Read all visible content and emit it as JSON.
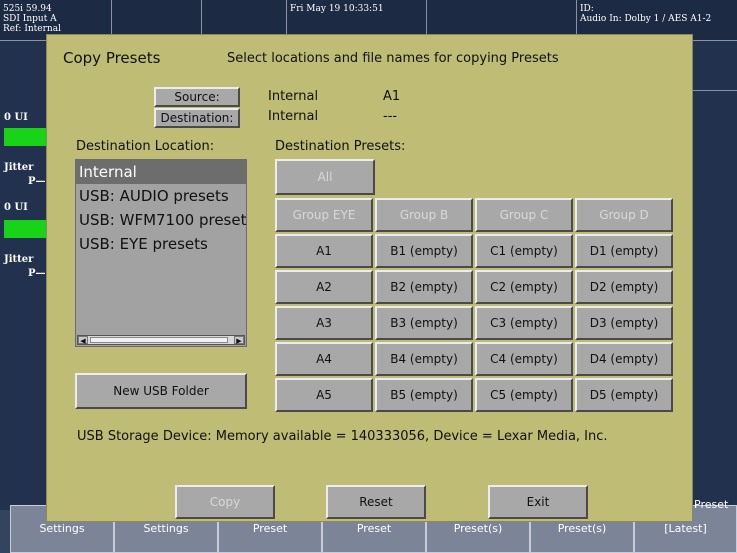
{
  "background": {
    "top_cells": [
      {
        "lines": [
          "525i 59.94",
          "SDI Input A",
          "Ref: Internal"
        ]
      },
      {
        "lines": [
          ""
        ]
      },
      {
        "lines": [
          ""
        ]
      },
      {
        "lines": [
          "Fri May 19 10:33:51"
        ]
      },
      {
        "lines": [
          ""
        ]
      },
      {
        "lines": [
          "ID:",
          "Audio In: Dolby 1 / AES A1-2"
        ]
      }
    ],
    "left_labels": [
      "0 UI",
      "Jitter",
      "P—",
      "0 UI",
      "Jitter",
      "P—"
    ],
    "bottom_buttons": [
      "Settings",
      "Settings",
      "Preset",
      "Preset",
      "Preset(s)",
      "Preset(s)",
      "[Latest]"
    ],
    "right_text": "Preset"
  },
  "dialog": {
    "title": "Copy Presets",
    "subtitle": "Select locations and file names for copying Presets",
    "source_button": "Source:",
    "destination_button": "Destination:",
    "source_location": "Internal",
    "source_preset": "A1",
    "destination_location": "Internal",
    "destination_preset": "---",
    "destination_location_label": "Destination Location:",
    "destination_presets_label": "Destination Presets:",
    "locations": [
      "Internal",
      "USB: AUDIO presets",
      "USB: WFM7100 presets",
      "USB: EYE presets"
    ],
    "all_button": "All",
    "group_headers": [
      "Group EYE",
      "Group B",
      "Group C",
      "Group D"
    ],
    "preset_rows": [
      [
        "A1",
        "B1 (empty)",
        "C1 (empty)",
        "D1 (empty)"
      ],
      [
        "A2",
        "B2 (empty)",
        "C2 (empty)",
        "D2 (empty)"
      ],
      [
        "A3",
        "B3 (empty)",
        "C3 (empty)",
        "D3 (empty)"
      ],
      [
        "A4",
        "B4 (empty)",
        "C4 (empty)",
        "D4 (empty)"
      ],
      [
        "A5",
        "B5 (empty)",
        "C5 (empty)",
        "D5 (empty)"
      ]
    ],
    "new_usb_folder_button": "New USB Folder",
    "usb_status": "USB Storage Device:  Memory available = 140333056, Device = Lexar Media, Inc.",
    "copy_button": "Copy",
    "reset_button": "Reset",
    "exit_button": "Exit"
  }
}
